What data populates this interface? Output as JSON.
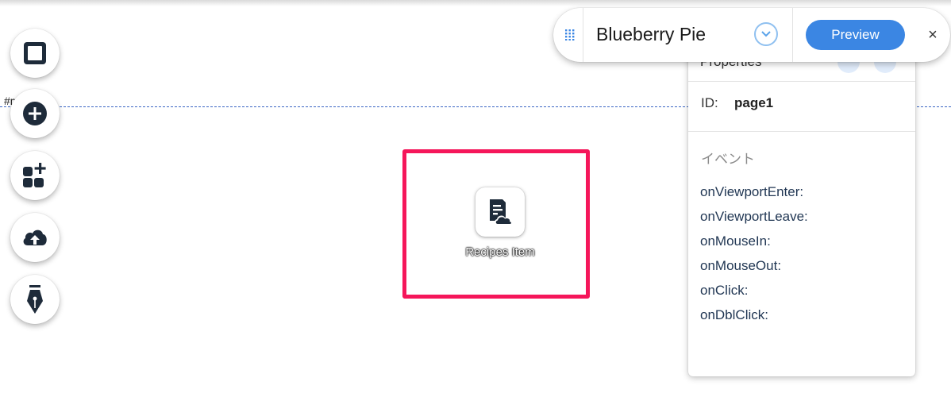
{
  "topbar": {
    "page_name": "Blueberry Pie",
    "preview_label": "Preview",
    "close_glyph": "×",
    "drag_icon": "drag-handle-icon",
    "dropdown_icon": "chevron-down-icon"
  },
  "canvas": {
    "anchor_label": "#m",
    "item": {
      "label": "Recipes Item",
      "icon": "dynamic-page-icon"
    },
    "highlight_color": "#f5165a"
  },
  "toolbar": {
    "items": [
      {
        "icon": "page-square-icon"
      },
      {
        "icon": "add-plus-icon"
      },
      {
        "icon": "add-apps-icon"
      },
      {
        "icon": "upload-cloud-icon"
      },
      {
        "icon": "pen-nib-icon"
      }
    ]
  },
  "properties": {
    "title": "Properties",
    "id_label": "ID:",
    "id_value": "page1",
    "events_heading": "イベント",
    "events": [
      "onViewportEnter:",
      "onViewportLeave:",
      "onMouseIn:",
      "onMouseOut:",
      "onClick:",
      "onDblClick:"
    ]
  },
  "colors": {
    "accent_blue": "#3b86e3",
    "event_text": "#1f3552"
  }
}
